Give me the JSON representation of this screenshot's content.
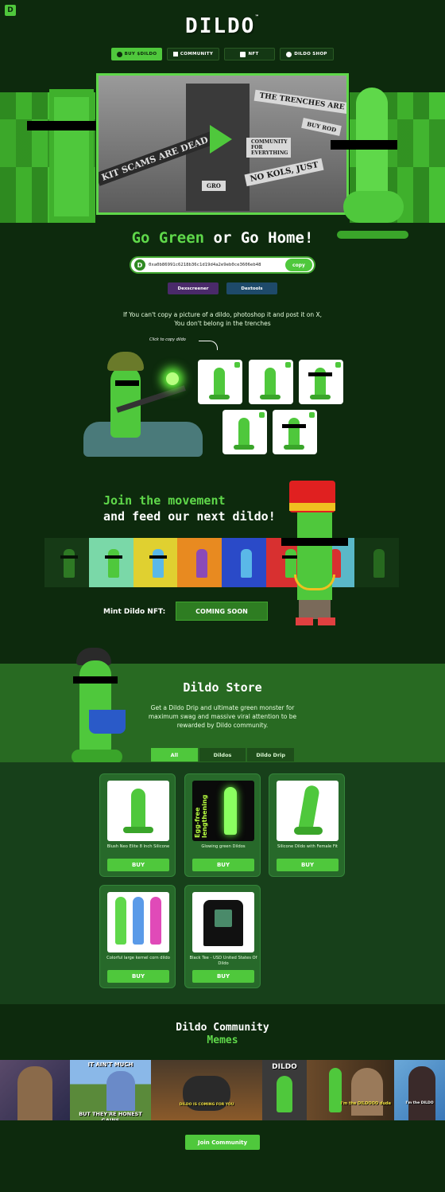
{
  "header": {
    "corner_icon": "dildo-d-icon",
    "logo": "DILDO",
    "logo_mark": "™"
  },
  "nav": {
    "items": [
      {
        "label": "BUY $DILDO",
        "icon": "coin-icon",
        "active": true
      },
      {
        "label": "COMMUNITY",
        "icon": "chart-icon",
        "active": false
      },
      {
        "label": "NFT",
        "icon": "frame-icon",
        "active": false
      },
      {
        "label": "DILDO SHOP",
        "icon": "cart-icon",
        "active": false
      }
    ]
  },
  "hero": {
    "banners": [
      "THE TRENCHES ARE",
      "BUY ROD",
      "COMMUNITY FOR EVERYTHING",
      "KIT SCAMS ARE DEAD",
      "NO KOLS, JUST",
      "GRO"
    ]
  },
  "tagline": {
    "green": "Go Green",
    "white": " or Go Home!"
  },
  "contract": {
    "address": "0xa0b86991c6218b36c1d19d4a2e9eb0ce3606eb48",
    "copy_label": "copy"
  },
  "links": {
    "dexscreener": "Dexscreener",
    "dextools": "Dextools"
  },
  "copy_section": {
    "instructions": "If You can't copy a picture of a dildo, photoshop it and post it on X, You don't belong in the trenches",
    "hint": "Click to copy dildo"
  },
  "movement": {
    "line1": "Join the movement",
    "line2": "and feed our next dildo!",
    "mint_label": "Mint Dildo NFT:",
    "mint_button": "COMING SOON"
  },
  "store": {
    "title": "Dildo Store",
    "description": "Get a Dildo Drip and ultimate green monster for maximum swag and massive viral attention to be rewarded by Dildo community.",
    "tabs": [
      {
        "label": "All",
        "active": true
      },
      {
        "label": "Dildos",
        "active": false
      },
      {
        "label": "Dildo Drip",
        "active": false
      }
    ],
    "buy_label": "BUY",
    "products": [
      {
        "name": "Blush Neo Elite 8 Inch Silicone"
      },
      {
        "name": "Glowing green Dildos",
        "image_text": "Egg-free lengthening"
      },
      {
        "name": "Silicone Dildo with Female Fit"
      },
      {
        "name": "Colorful large kernel corn dildo"
      },
      {
        "name": "Black Tee - USD United States Of Dildo"
      }
    ]
  },
  "community": {
    "title": "Dildo Community",
    "subtitle": "Memes",
    "meme_captions": [
      "IT AIN'T MUCH",
      "BUT THEY'RE HONEST GAINS",
      "DILDO",
      "DILDO IS COMING FOR YOU",
      "I'm the DILDOOO dude",
      "I'm the DILDO"
    ],
    "join_button": "Join Community"
  },
  "colors": {
    "bg": "#0d2a0d",
    "accent": "#4fc83c",
    "store_band": "#286a22"
  }
}
